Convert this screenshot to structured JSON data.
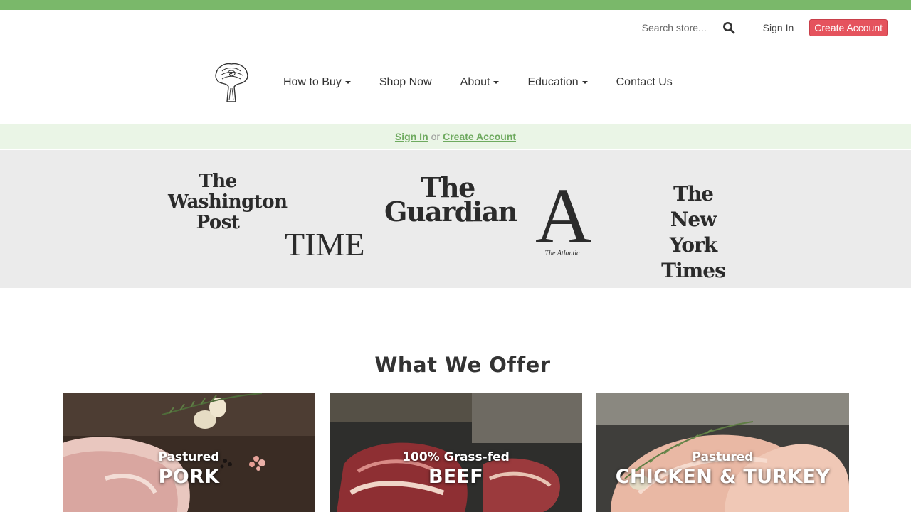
{
  "colors": {
    "accent_green": "#7ab86a",
    "create_account": "#e5535d",
    "strip_bg": "#eaf5e6",
    "press_bg": "#ebebeb"
  },
  "header": {
    "search": {
      "placeholder": "Search store...",
      "icon": "search-icon"
    },
    "sign_in": "Sign In",
    "create_account": "Create Account"
  },
  "nav": {
    "logo": "tree-logo",
    "items": [
      {
        "label": "How to Buy",
        "dropdown": true
      },
      {
        "label": "Shop Now",
        "dropdown": false
      },
      {
        "label": "About",
        "dropdown": true
      },
      {
        "label": "Education",
        "dropdown": true
      },
      {
        "label": "Contact Us",
        "dropdown": false
      }
    ]
  },
  "account_strip": {
    "sign_in": "Sign In",
    "or": "or",
    "create_account": "Create Account"
  },
  "press": {
    "wapo": [
      "The",
      "Washington",
      "Post"
    ],
    "time": "TIME",
    "guardian": [
      "The",
      "Guardian"
    ],
    "atlantic": {
      "letter": "A",
      "name": "The Atlantic"
    },
    "nyt": [
      "The",
      "New York",
      "Times"
    ]
  },
  "offer": {
    "title": "What We Offer",
    "cards": [
      {
        "sub": "Pastured",
        "main": "PORK"
      },
      {
        "sub": "100% Grass-fed",
        "main": "BEEF"
      },
      {
        "sub": "Pastured",
        "main": "CHICKEN & TURKEY"
      }
    ]
  }
}
